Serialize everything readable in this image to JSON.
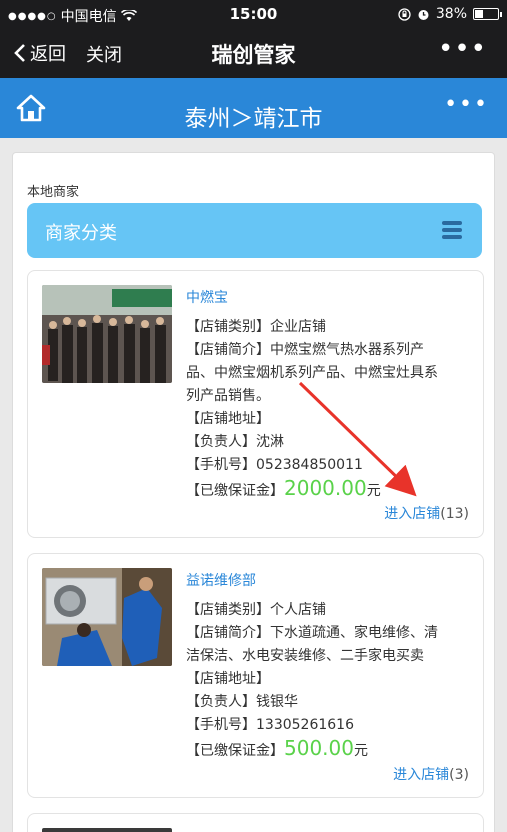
{
  "status": {
    "carrier": "中国电信",
    "time": "15:00",
    "battery": "38%",
    "battery_level": 0.38
  },
  "nav": {
    "back_label": "返回",
    "close_label": "关闭",
    "title": "瑞创管家",
    "more": "•••"
  },
  "city": {
    "title": "泰州＞靖江市",
    "more": "•••"
  },
  "section_label": "本地商家",
  "category": {
    "label": "商家分类"
  },
  "merchants": [
    {
      "name": "中燃宝",
      "type_line": "【店铺类别】企业店铺",
      "intro_line1": "【店铺简介】中燃宝燃气热水器系列产",
      "intro_line2": "品、中燃宝烟机系列产品、中燃宝灶具系",
      "intro_line3": "列产品销售。",
      "address_line": "【店铺地址】",
      "owner_line": "【负责人】沈淋",
      "phone_line": "【手机号】052384850011",
      "deposit_label": "【已缴保证金】",
      "deposit_amount": "2000.00",
      "deposit_unit": "元",
      "enter_label": "进入店铺",
      "enter_count": "(13)"
    },
    {
      "name": "益诺维修部",
      "type_line": "【店铺类别】个人店铺",
      "intro_line1": "【店铺简介】下水道疏通、家电维修、清",
      "intro_line2": "洁保洁、水电安装维修、二手家电买卖",
      "address_line": "【店铺地址】",
      "owner_line": "【负责人】钱银华",
      "phone_line": "【手机号】13305261616",
      "deposit_label": "【已缴保证金】",
      "deposit_amount": "500.00",
      "deposit_unit": "元",
      "enter_label": "进入店铺",
      "enter_count": "(3)"
    }
  ]
}
